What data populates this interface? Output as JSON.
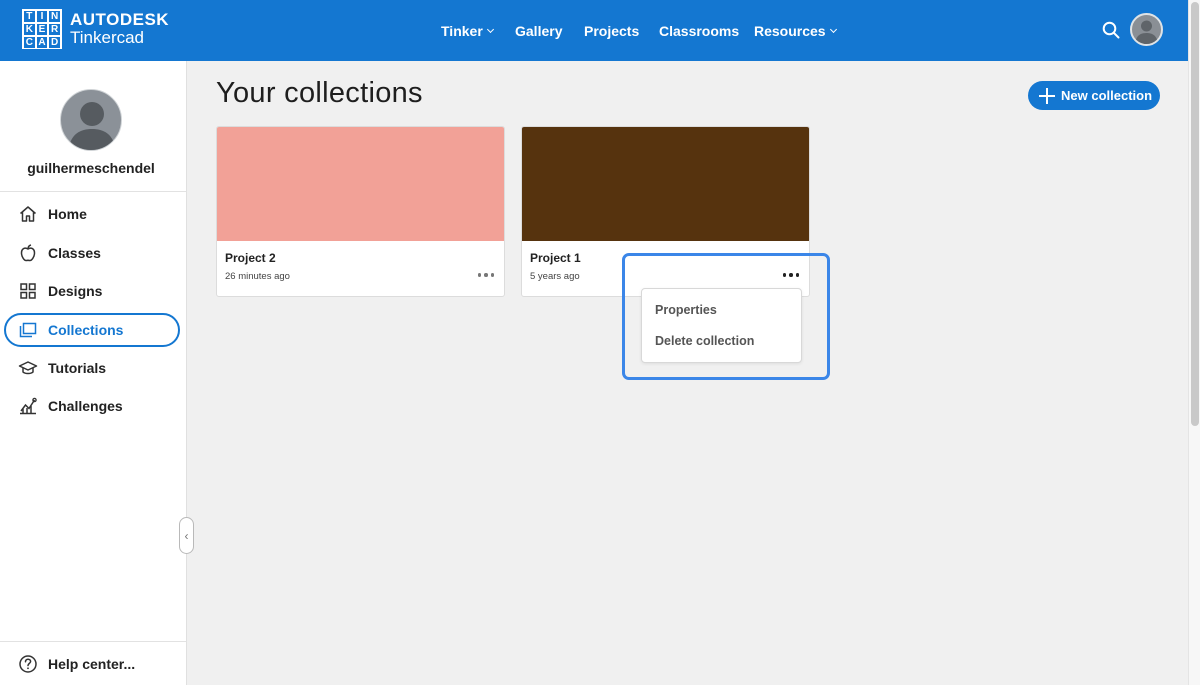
{
  "header": {
    "logo_letters": [
      "T",
      "I",
      "N",
      "K",
      "E",
      "R",
      "C",
      "A",
      "D"
    ],
    "brand_top": "AUTODESK",
    "brand_bottom": "Tinkercad",
    "nav": [
      {
        "label": "Tinker",
        "has_dropdown": true
      },
      {
        "label": "Gallery",
        "has_dropdown": false
      },
      {
        "label": "Projects",
        "has_dropdown": false
      },
      {
        "label": "Classrooms",
        "has_dropdown": false
      },
      {
        "label": "Resources",
        "has_dropdown": true
      }
    ],
    "search_icon": "search-icon"
  },
  "sidebar": {
    "username": "guilhermeschendel",
    "items": [
      {
        "label": "Home",
        "icon": "home-icon"
      },
      {
        "label": "Classes",
        "icon": "apple-icon"
      },
      {
        "label": "Designs",
        "icon": "grid-icon"
      },
      {
        "label": "Collections",
        "icon": "folder-icon",
        "active": true
      },
      {
        "label": "Tutorials",
        "icon": "graduation-cap-icon"
      },
      {
        "label": "Challenges",
        "icon": "chart-icon"
      }
    ],
    "help_label": "Help center..."
  },
  "main": {
    "title": "Your collections",
    "new_collection_label": "New collection",
    "cards": [
      {
        "name": "Project 2",
        "time": "26 minutes ago",
        "color": "#f2a197"
      },
      {
        "name": "Project 1",
        "time": "5 years ago",
        "color": "#56330e"
      }
    ],
    "menu": {
      "items": [
        "Properties",
        "Delete collection"
      ]
    }
  },
  "colors": {
    "accent": "#1477d1",
    "highlight": "#3b86e8"
  }
}
